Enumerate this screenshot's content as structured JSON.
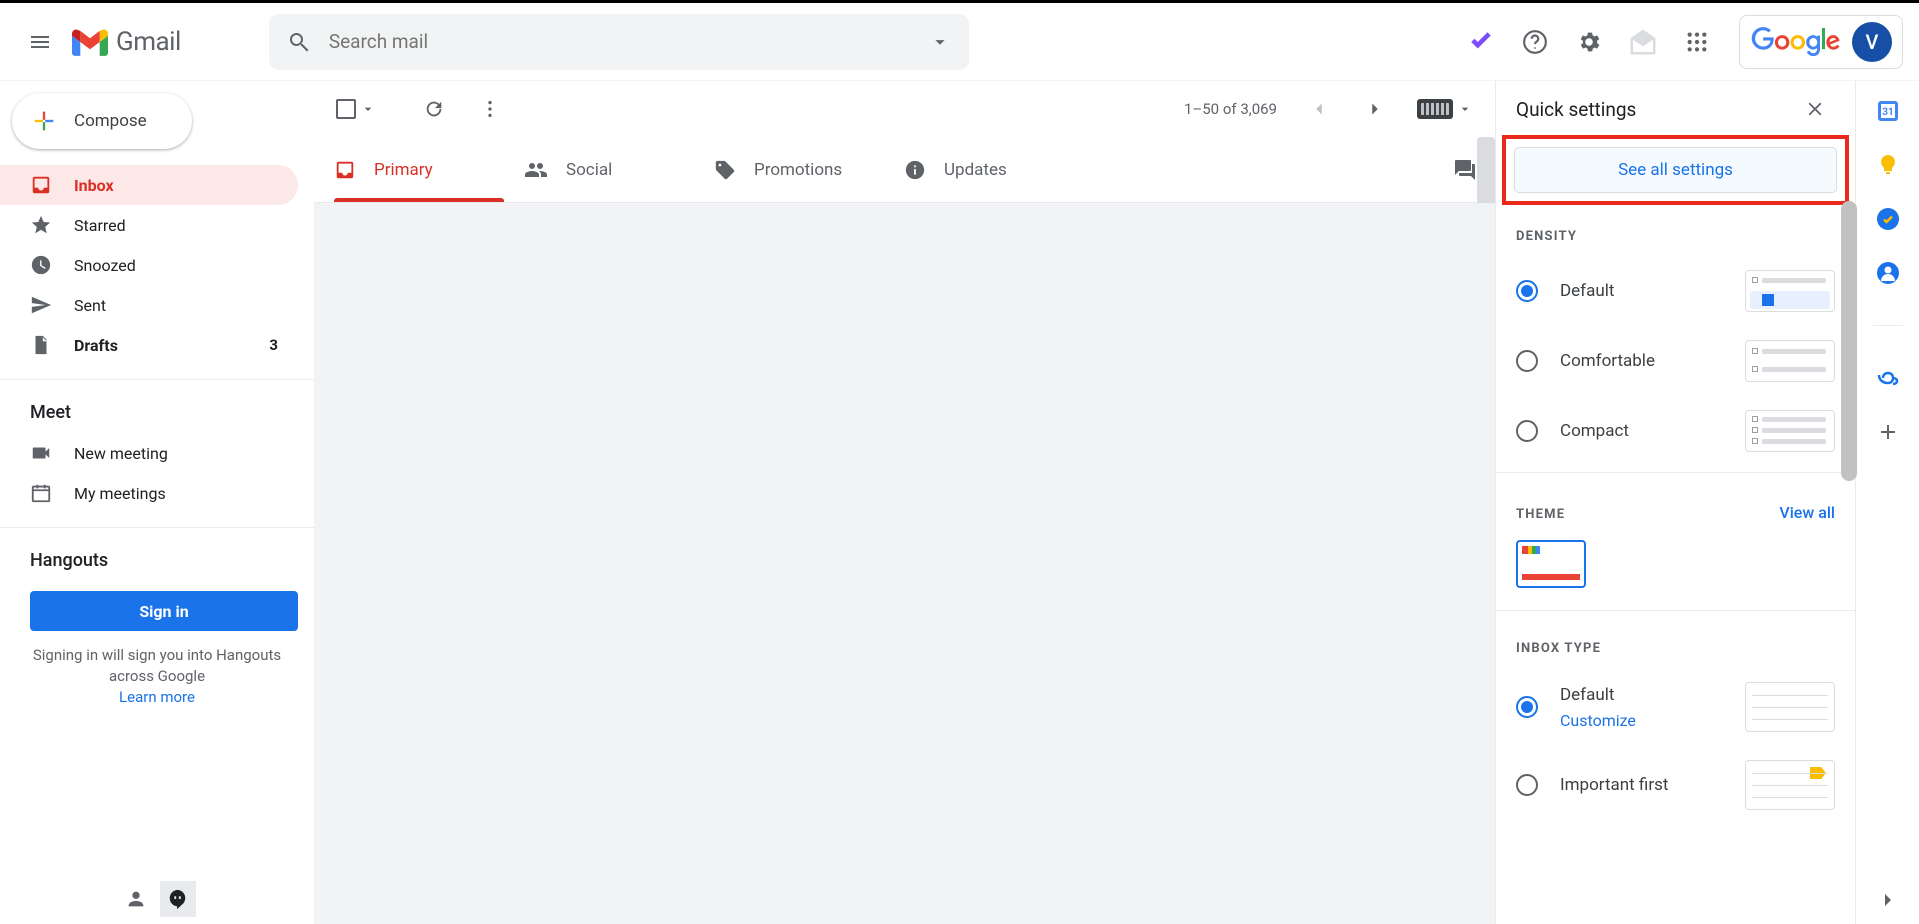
{
  "header": {
    "app_name": "Gmail",
    "search_placeholder": "Search mail",
    "avatar_initial": "V",
    "google_word": "Google"
  },
  "sidebar": {
    "compose": "Compose",
    "items": [
      {
        "label": "Inbox",
        "count": ""
      },
      {
        "label": "Starred",
        "count": ""
      },
      {
        "label": "Snoozed",
        "count": ""
      },
      {
        "label": "Sent",
        "count": ""
      },
      {
        "label": "Drafts",
        "count": "3"
      }
    ],
    "meet_label": "Meet",
    "meet_items": [
      {
        "label": "New meeting"
      },
      {
        "label": "My meetings"
      }
    ],
    "hangouts_label": "Hangouts",
    "signin_label": "Sign in",
    "hangouts_msg": "Signing in will sign you into Hangouts across Google",
    "learn_more": "Learn more"
  },
  "toolbar": {
    "page_info": "1–50 of 3,069"
  },
  "tabs": [
    {
      "label": "Primary"
    },
    {
      "label": "Social"
    },
    {
      "label": "Promotions"
    },
    {
      "label": "Updates"
    }
  ],
  "qsettings": {
    "title": "Quick settings",
    "see_all": "See all settings",
    "density_title": "DENSITY",
    "density_options": [
      {
        "label": "Default"
      },
      {
        "label": "Comfortable"
      },
      {
        "label": "Compact"
      }
    ],
    "theme_title": "THEME",
    "theme_view_all": "View all",
    "inbox_type_title": "INBOX TYPE",
    "inbox_default_label": "Default",
    "inbox_default_customize": "Customize",
    "inbox_important_label": "Important first"
  }
}
